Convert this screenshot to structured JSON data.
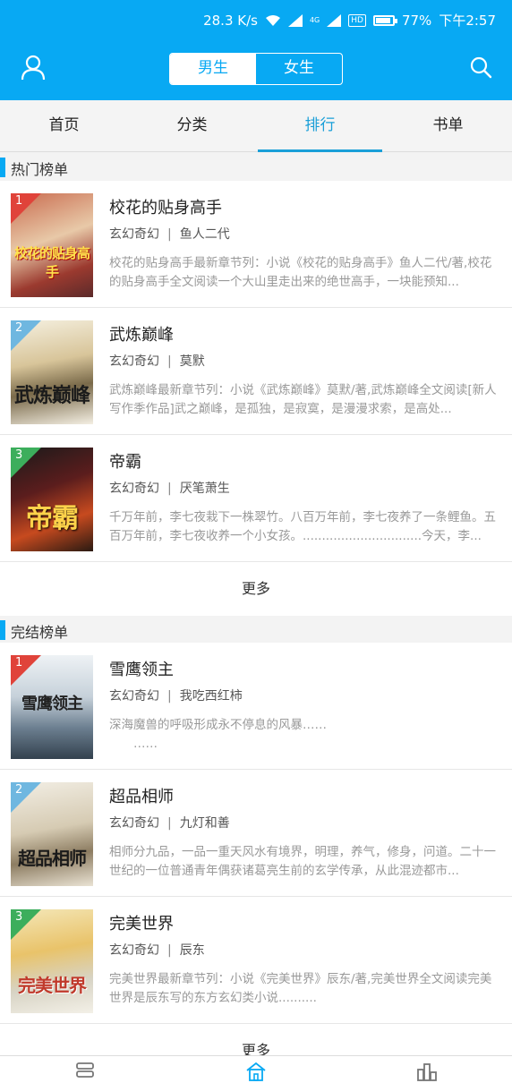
{
  "status_bar": {
    "speed": "28.3 K/s",
    "network": "4G",
    "hd": "HD",
    "battery": "77%",
    "time": "下午2:57"
  },
  "header": {
    "gender_tabs": [
      {
        "label": "男生",
        "selected": true
      },
      {
        "label": "女生",
        "selected": false
      }
    ],
    "user_icon": "user-icon",
    "search_icon": "search-icon"
  },
  "tabs": [
    {
      "label": "首页"
    },
    {
      "label": "分类"
    },
    {
      "label": "排行",
      "active": true
    },
    {
      "label": "书单"
    }
  ],
  "hot": {
    "title": "热门榜单",
    "more": "更多",
    "items": [
      {
        "rank": "1",
        "title": "校花的贴身高手",
        "genre": "玄幻奇幻",
        "author": "鱼人二代",
        "desc": "校花的贴身高手最新章节列：小说《校花的贴身高手》鱼人二代/著,校花的贴身高手全文阅读一个大山里走出来的绝世高手，一块能预知...",
        "cover_text": "校花的贴身高手",
        "badge_color": "#e0433a"
      },
      {
        "rank": "2",
        "title": "武炼巅峰",
        "genre": "玄幻奇幻",
        "author": "莫默",
        "desc": "武炼巅峰最新章节列：小说《武炼巅峰》莫默/著,武炼巅峰全文阅读[新人写作季作品]武之巅峰，是孤独，是寂寞，是漫漫求索，是高处...",
        "cover_text": "武炼巅峰",
        "badge_color": "#6fb7e0"
      },
      {
        "rank": "3",
        "title": "帝霸",
        "genre": "玄幻奇幻",
        "author": "厌笔萧生",
        "desc": "千万年前，李七夜栽下一株翠竹。八百万年前，李七夜养了一条鲤鱼。五百万年前，李七夜收养一个小女孩。...............................今天，李...",
        "cover_text": "帝霸",
        "badge_color": "#3cae5c"
      }
    ]
  },
  "finished": {
    "title": "完结榜单",
    "more": "更多",
    "items": [
      {
        "rank": "1",
        "title": "雪鹰领主",
        "genre": "玄幻奇幻",
        "author": "我吃西红柿",
        "desc": "深海魔兽的呼吸形成永不停息的风暴……\n　　……",
        "cover_text": "雪鹰领主",
        "badge_color": "#e0433a"
      },
      {
        "rank": "2",
        "title": "超品相师",
        "genre": "玄幻奇幻",
        "author": "九灯和善",
        "desc": "相师分九品，一品一重天风水有境界，明理，养气，修身，问道。二十一世纪的一位普通青年偶获诸葛亮生前的玄学传承，从此混迹都市...",
        "cover_text": "超品相师",
        "badge_color": "#6fb7e0"
      },
      {
        "rank": "3",
        "title": "完美世界",
        "genre": "玄幻奇幻",
        "author": "辰东",
        "desc": "完美世界最新章节列：小说《完美世界》辰东/著,完美世界全文阅读完美世界是辰东写的东方玄幻类小说..........",
        "cover_text": "完美世界",
        "badge_color": "#3cae5c"
      }
    ]
  },
  "bottom_nav": [
    {
      "icon": "bookshelf-icon"
    },
    {
      "icon": "home-icon",
      "active": true
    },
    {
      "icon": "ranking-icon"
    }
  ],
  "colors": {
    "accent": "#08a9f3",
    "active_tab": "#1a9fd8"
  }
}
